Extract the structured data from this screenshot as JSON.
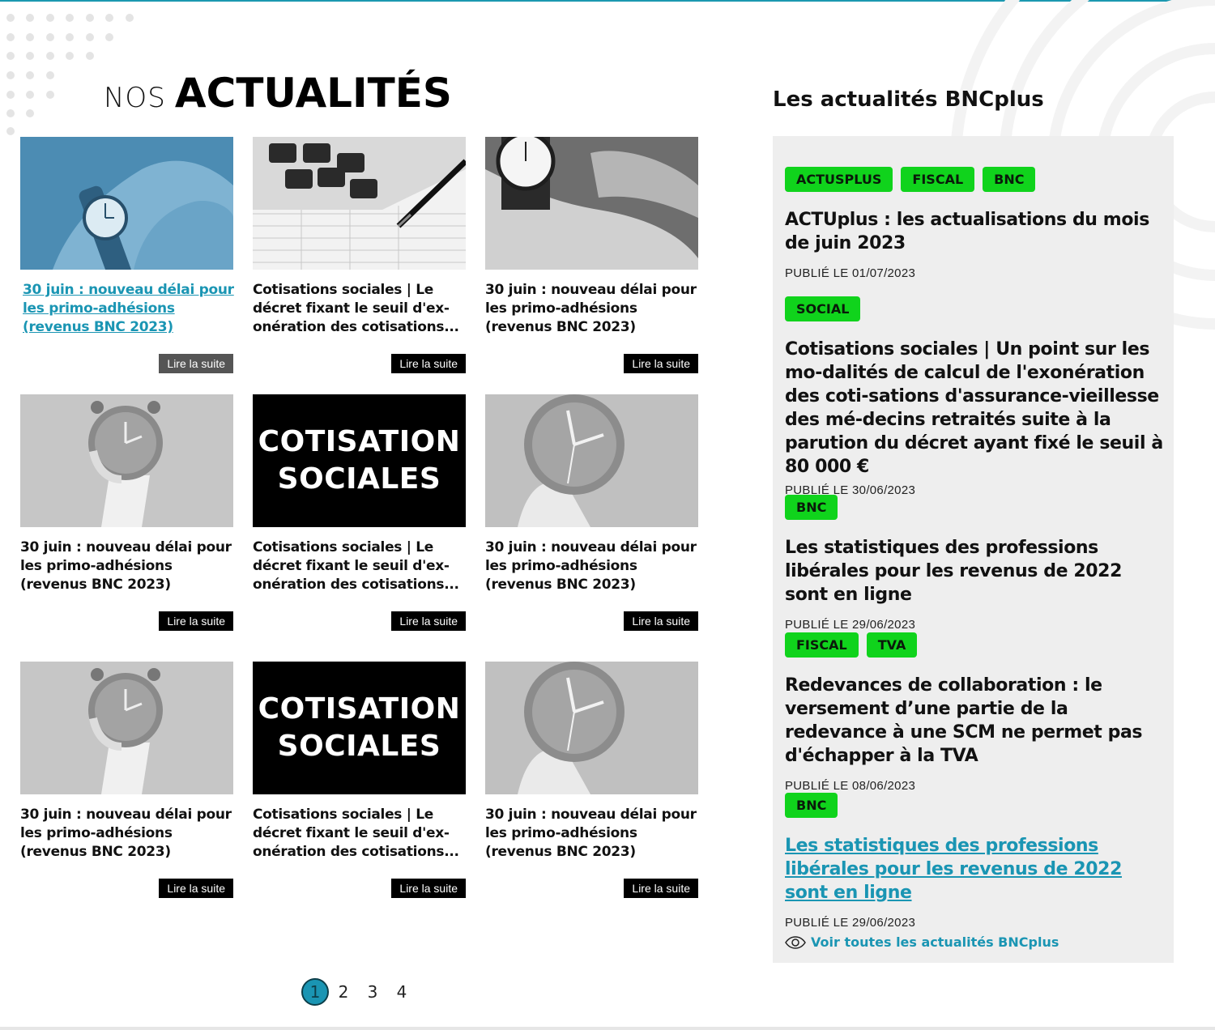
{
  "section": {
    "title_light": "NOS",
    "title_bold": "ACTUALITÉS"
  },
  "cards": [
    {
      "title": "30 juin : nouveau délai pour les primo-adhésions (revenus BNC 2023) ",
      "more": "Lire la suite",
      "image": "watch-wrist-blue"
    },
    {
      "title": "Cotisations sociales | Le décret fixant le seuil d'ex-onération des cotisations...",
      "more": "Lire la suite",
      "image": "calculator"
    },
    {
      "title": "30 juin : nouveau délai pour les primo-adhésions (revenus BNC 2023)",
      "more": "Lire la suite",
      "image": "watch-wrist-grey"
    },
    {
      "title": "30 juin : nouveau délai pour les primo-adhésions (revenus BNC 2023)",
      "more": "Lire la suite",
      "image": "alarm-clock"
    },
    {
      "title": "Cotisations sociales | Le décret fixant le seuil d'ex-onération des cotisations...",
      "more": "Lire la suite",
      "image": "cotisation-sociales"
    },
    {
      "title": "30 juin : nouveau délai pour les primo-adhésions (revenus BNC 2023)",
      "more": "Lire la suite",
      "image": "alarm-clock-large"
    },
    {
      "title": "30 juin : nouveau délai pour les primo-adhésions (revenus BNC 2023)",
      "more": "Lire la suite",
      "image": "alarm-clock"
    },
    {
      "title": "Cotisations sociales | Le décret fixant le seuil d'ex-onération des cotisations...",
      "more": "Lire la suite",
      "image": "cotisation-sociales"
    },
    {
      "title": "30 juin : nouveau délai pour les primo-adhésions (revenus BNC 2023)",
      "more": "Lire la suite",
      "image": "alarm-clock-large"
    }
  ],
  "cotisation_image": {
    "line1": "COTISATION",
    "line2": "SOCIALES"
  },
  "pagination": {
    "pages": [
      "1",
      "2",
      "3",
      "4"
    ],
    "current": "1"
  },
  "sidebar": {
    "title": "Les actualités BNCplus",
    "news": [
      {
        "tags": [
          "ACTUSPLUS",
          "FISCAL",
          "BNC"
        ],
        "title": "ACTUplus : les actualisations du mois de juin 2023",
        "date": "PUBLIÉ LE  01/07/2023"
      },
      {
        "tags": [
          "SOCIAL"
        ],
        "title": "Cotisations sociales | Un point sur les mo-dalités de calcul de l'exonération des coti-sations d'assurance-vieillesse des mé-decins retraités suite à la parution du décret ayant fixé le seuil à 80 000 €",
        "date": "PUBLIÉ LE 30/06/2023"
      },
      {
        "tags": [
          "BNC"
        ],
        "title": "Les statistiques des professions libérales pour les revenus de 2022 sont en ligne",
        "date": "PUBLIÉ LE  29/06/2023"
      },
      {
        "tags": [
          "FISCAL",
          "TVA"
        ],
        "title": "Redevances de collaboration : le versement d’une partie de la redevance à une SCM ne permet pas d'échapper à la TVA",
        "date": "PUBLIÉ LE 08/06/2023"
      },
      {
        "tags": [
          "BNC"
        ],
        "title": "Les statistiques des professions libérales pour les revenus de 2022 sont en ligne",
        "date": "PUBLIÉ LE  29/06/2023"
      }
    ],
    "see_all": "Voir toutes les actualités BNCplus",
    "see_all_icon": "eye-icon"
  },
  "colors": {
    "accent": "#1a95b3",
    "tag_green": "#10d31c",
    "sidebar_bg": "#eeeeee"
  }
}
